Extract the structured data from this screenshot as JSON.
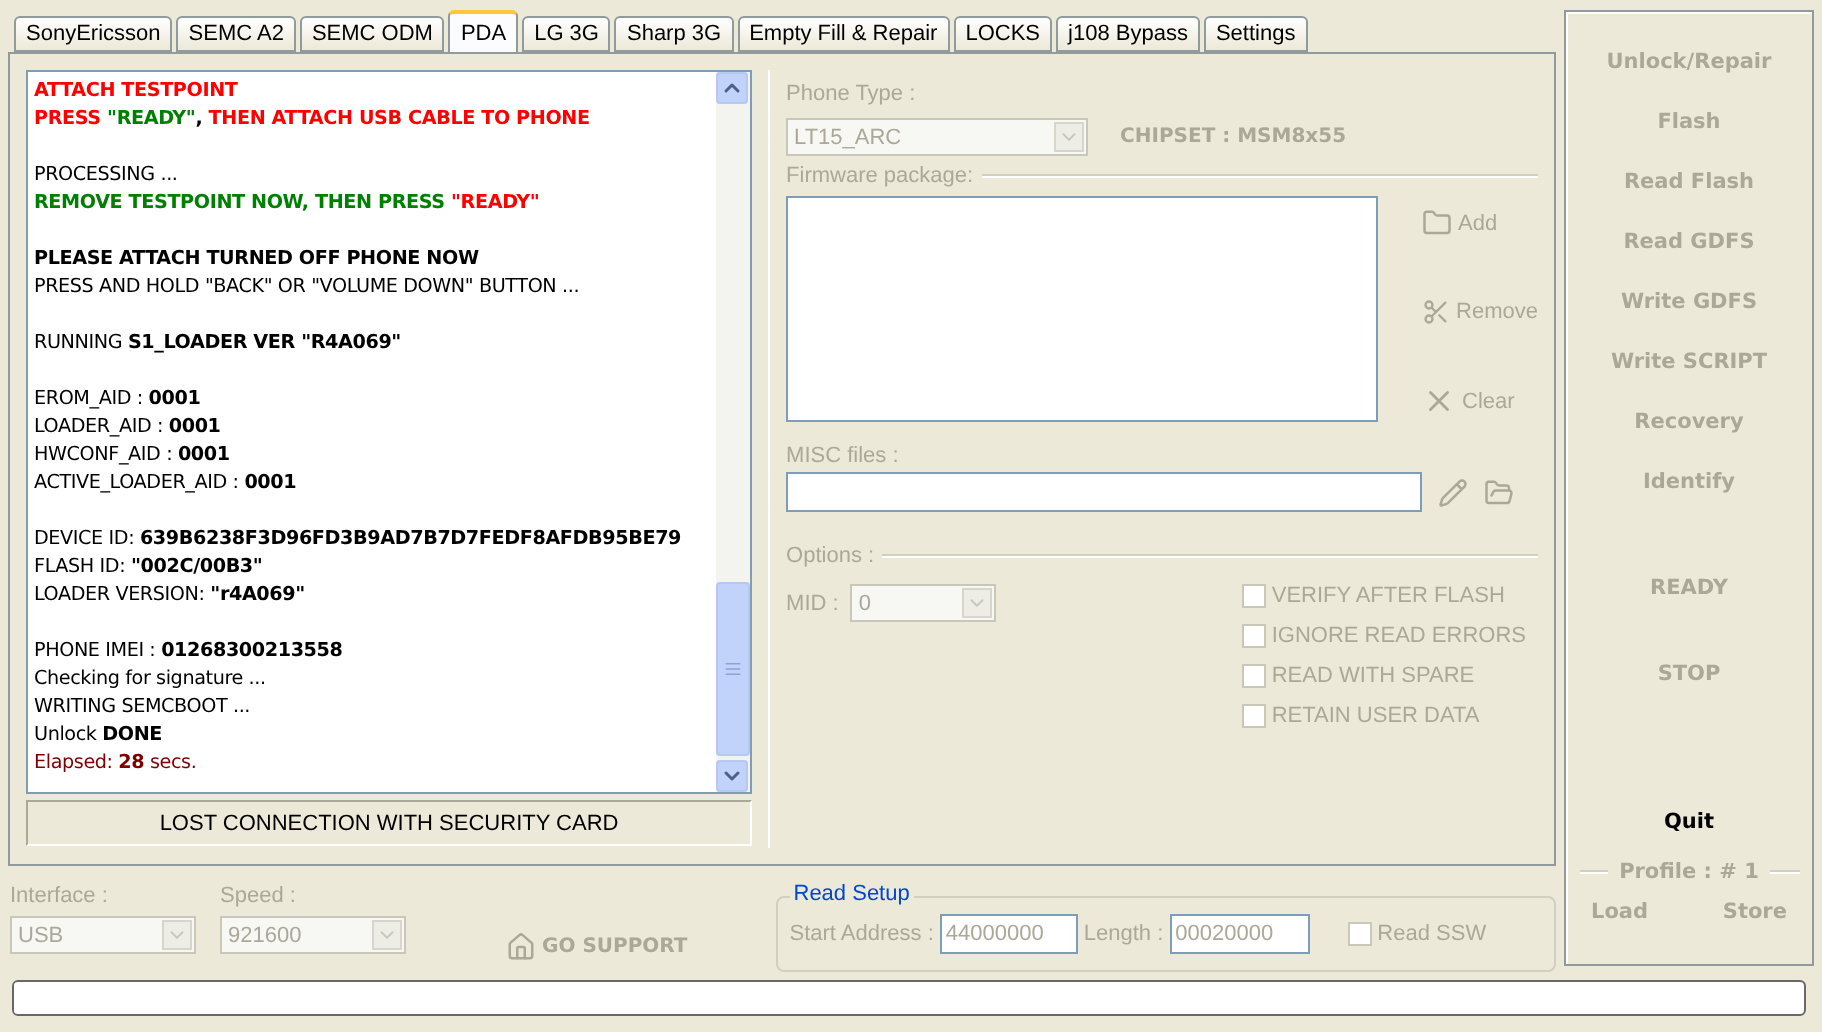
{
  "tabs": [
    {
      "label": "SonyEricsson",
      "selected": false
    },
    {
      "label": "SEMC A2",
      "selected": false
    },
    {
      "label": "SEMC ODM",
      "selected": false
    },
    {
      "label": "PDA",
      "selected": true
    },
    {
      "label": "LG 3G",
      "selected": false
    },
    {
      "label": "Sharp 3G",
      "selected": false
    },
    {
      "label": "Empty Fill & Repair",
      "selected": false
    },
    {
      "label": "LOCKS",
      "selected": false
    },
    {
      "label": "j108 Bypass",
      "selected": false
    },
    {
      "label": "Settings",
      "selected": false
    }
  ],
  "log": {
    "blocks": [
      [
        [
          {
            "text": "ATTACH TESTPOINT",
            "color": "#ff0000",
            "bold": true
          }
        ],
        [
          {
            "text": "PRESS ",
            "color": "#ff0000",
            "bold": true
          },
          {
            "text": "\"READY\"",
            "color": "#008000",
            "bold": true
          },
          {
            "text": ", ",
            "color": "#000000",
            "bold": true
          },
          {
            "text": "THEN ATTACH USB CABLE TO PHONE",
            "color": "#ff0000",
            "bold": true
          }
        ]
      ],
      [
        [
          {
            "text": "PROCESSING ...",
            "color": "#000000",
            "bold": false
          }
        ],
        [
          {
            "text": "REMOVE TESTPOINT NOW, THEN PRESS ",
            "color": "#008000",
            "bold": true
          },
          {
            "text": "\"READY\"",
            "color": "#ff0000",
            "bold": true
          }
        ]
      ],
      [
        [
          {
            "text": "PLEASE ATTACH TURNED OFF PHONE NOW",
            "color": "#000000",
            "bold": true
          }
        ],
        [
          {
            "text": "PRESS AND HOLD \"BACK\" OR \"VOLUME DOWN\" BUTTON ...",
            "color": "#000000",
            "bold": false
          }
        ]
      ],
      [
        [
          {
            "text": "RUNNING ",
            "color": "#000000",
            "bold": false
          },
          {
            "text": "S1_LOADER VER \"R4A069\"",
            "color": "#000000",
            "bold": true
          }
        ]
      ],
      [
        [
          {
            "text": "EROM_AID : ",
            "color": "#000000",
            "bold": false
          },
          {
            "text": "0001",
            "color": "#000000",
            "bold": true
          }
        ],
        [
          {
            "text": "LOADER_AID : ",
            "color": "#000000",
            "bold": false
          },
          {
            "text": "0001",
            "color": "#000000",
            "bold": true
          }
        ],
        [
          {
            "text": "HWCONF_AID : ",
            "color": "#000000",
            "bold": false
          },
          {
            "text": "0001",
            "color": "#000000",
            "bold": true
          }
        ],
        [
          {
            "text": "ACTIVE_LOADER_AID : ",
            "color": "#000000",
            "bold": false
          },
          {
            "text": "0001",
            "color": "#000000",
            "bold": true
          }
        ]
      ],
      [
        [
          {
            "text": "DEVICE ID: ",
            "color": "#000000",
            "bold": false
          },
          {
            "text": "639B6238F3D96FD3B9AD7B7D7FEDF8AFDB95BE79",
            "color": "#000000",
            "bold": true
          }
        ],
        [
          {
            "text": "FLASH ID: ",
            "color": "#000000",
            "bold": false
          },
          {
            "text": "\"002C/00B3\"",
            "color": "#000000",
            "bold": true
          }
        ],
        [
          {
            "text": "LOADER VERSION: ",
            "color": "#000000",
            "bold": false
          },
          {
            "text": "\"r4A069\"",
            "color": "#000000",
            "bold": true
          }
        ]
      ],
      [
        [
          {
            "text": "PHONE IMEI : ",
            "color": "#000000",
            "bold": false
          },
          {
            "text": "01268300213558",
            "color": "#000000",
            "bold": true
          }
        ],
        [
          {
            "text": "Checking for signature ...",
            "color": "#000000",
            "bold": false
          }
        ],
        [
          {
            "text": "WRITING SEMCBOOT ...",
            "color": "#000000",
            "bold": false
          }
        ],
        [
          {
            "text": "Unlock ",
            "color": "#000000",
            "bold": false
          },
          {
            "text": "DONE",
            "color": "#000000",
            "bold": true
          }
        ],
        [
          {
            "text": "Elapsed: ",
            "color": "#800000",
            "bold": false
          },
          {
            "text": "28",
            "color": "#800000",
            "bold": true
          },
          {
            "text": " secs.",
            "color": "#800000",
            "bold": false
          }
        ]
      ]
    ]
  },
  "status": "LOST CONNECTION WITH SECURITY CARD",
  "phone_type": {
    "label": "Phone Type :",
    "value": "LT15_ARC",
    "disabled": true
  },
  "chipset": "CHIPSET : MSM8x55",
  "firmware": {
    "label": "Firmware package:",
    "buttons": [
      {
        "kind": "add",
        "label": "Add"
      },
      {
        "kind": "remove",
        "label": "Remove"
      },
      {
        "kind": "clear",
        "label": "Clear"
      }
    ]
  },
  "misc_files": {
    "label": "MISC files :"
  },
  "options": {
    "label": "Options :",
    "mid_label": "MID :",
    "mid_value": "0",
    "checkboxes": [
      {
        "label": "VERIFY AFTER FLASH",
        "checked": false
      },
      {
        "label": "IGNORE READ ERRORS",
        "checked": false
      },
      {
        "label": "READ WITH SPARE",
        "checked": false
      },
      {
        "label": "RETAIN USER DATA",
        "checked": false
      }
    ]
  },
  "interface": {
    "label": "Interface :",
    "value": "USB"
  },
  "speed": {
    "label": "Speed :",
    "value": "921600"
  },
  "go_support": "GO SUPPORT",
  "read_setup": {
    "title": "Read Setup",
    "start_label": "Start Address :",
    "start_value": "44000000",
    "length_label": "Length :",
    "length_value": "00020000",
    "ssw": {
      "label": "Read SSW",
      "checked": false
    }
  },
  "actions": [
    {
      "label": "Unlock/Repair",
      "disabled": true
    },
    {
      "label": "Flash",
      "disabled": true
    },
    {
      "label": "Read Flash",
      "disabled": true
    },
    {
      "label": "Read GDFS",
      "disabled": true
    },
    {
      "label": "Write GDFS",
      "disabled": true
    },
    {
      "label": "Write SCRIPT",
      "disabled": true
    },
    {
      "label": "Recovery",
      "disabled": true
    },
    {
      "label": "Identify",
      "disabled": true
    }
  ],
  "controls": [
    {
      "label": "READY",
      "disabled": true
    },
    {
      "label": "STOP",
      "disabled": true
    }
  ],
  "quit": {
    "label": "Quit",
    "disabled": false
  },
  "profile": {
    "label": "Profile : # 1",
    "buttons": [
      {
        "label": "Load",
        "disabled": true
      },
      {
        "label": "Store",
        "disabled": true
      }
    ]
  },
  "progress": {
    "level": 0
  }
}
